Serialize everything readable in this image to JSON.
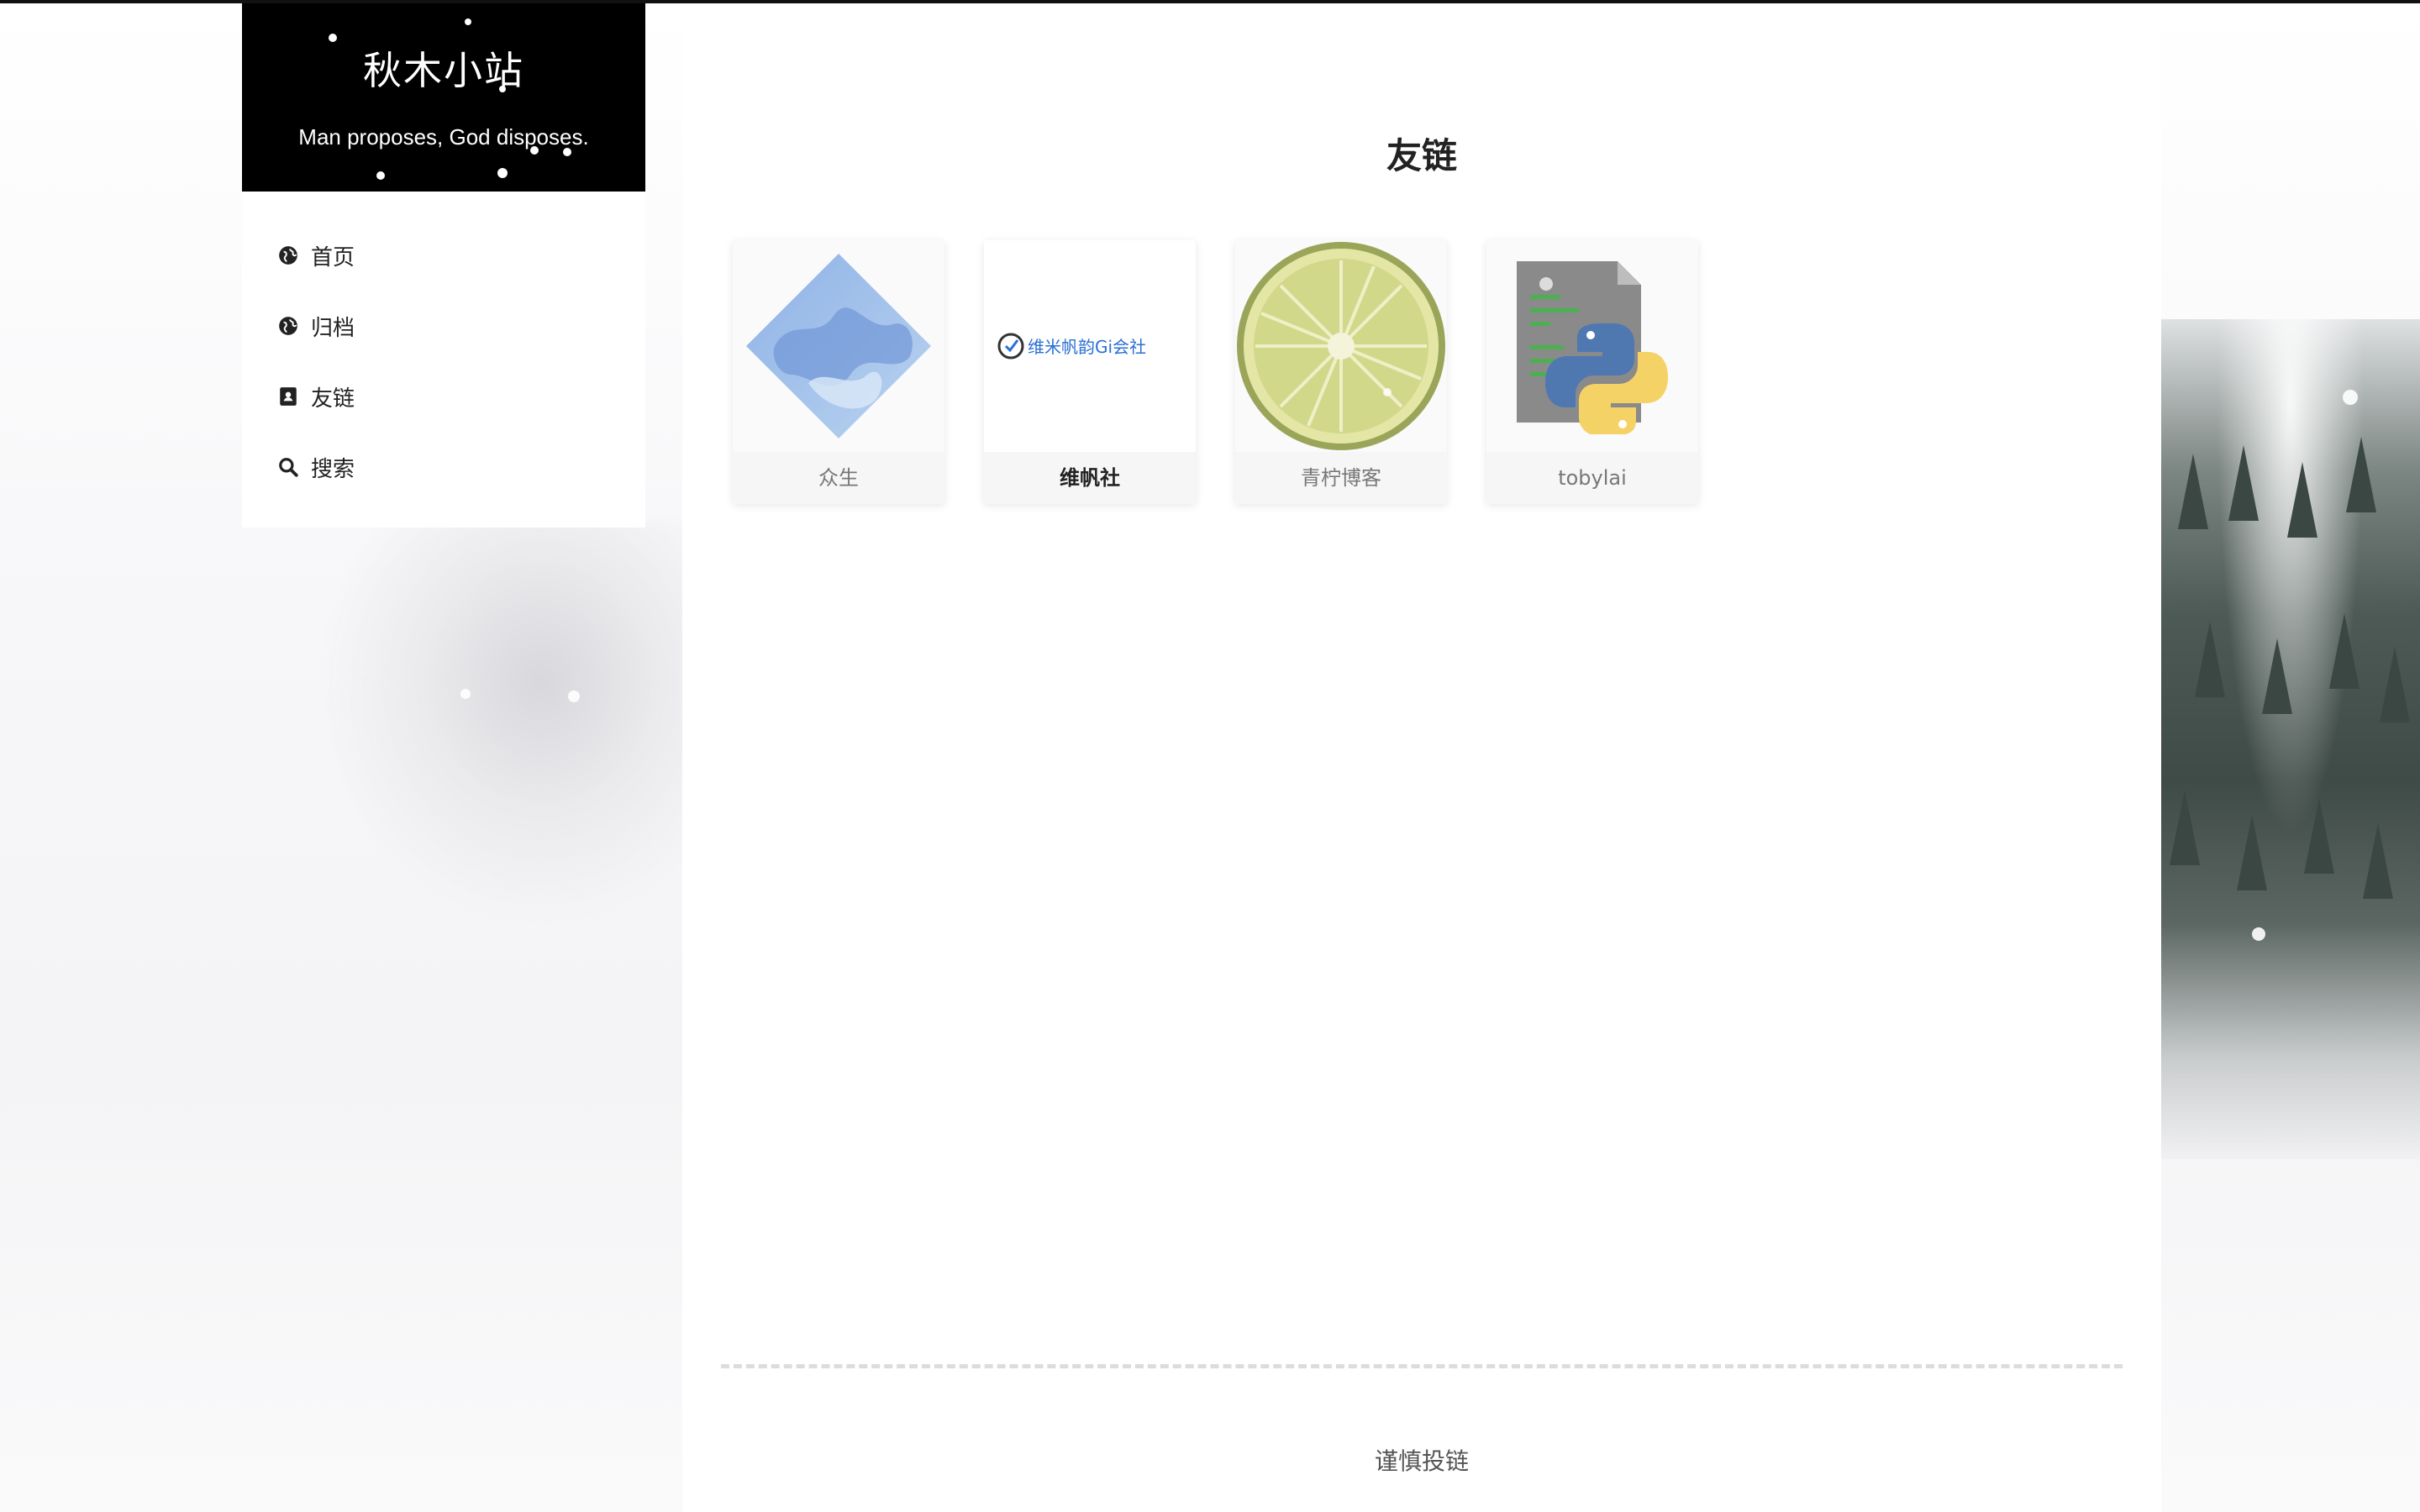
{
  "site": {
    "title": "秋木小站",
    "subtitle": "Man proposes, God disposes."
  },
  "nav": {
    "items": [
      {
        "label": "首页",
        "icon": "globe-icon"
      },
      {
        "label": "归档",
        "icon": "globe-icon"
      },
      {
        "label": "友链",
        "icon": "address-book-icon"
      },
      {
        "label": "搜索",
        "icon": "search-icon"
      }
    ]
  },
  "page": {
    "title": "友链"
  },
  "links": [
    {
      "name": "众生",
      "thumb": "blue-diamond-logo"
    },
    {
      "name": "维帆社",
      "thumb": "weifan-logo",
      "logo_text": "维米帆韵Gi会社"
    },
    {
      "name": "青柠博客",
      "thumb": "lime-slice-image"
    },
    {
      "name": "tobylai",
      "thumb": "python-file-icon"
    }
  ],
  "footer": {
    "note": "谨慎投链"
  },
  "colors": {
    "brand_bg": "#000000",
    "text": "#222222",
    "muted": "#777777",
    "divider": "#dcdcdc"
  }
}
